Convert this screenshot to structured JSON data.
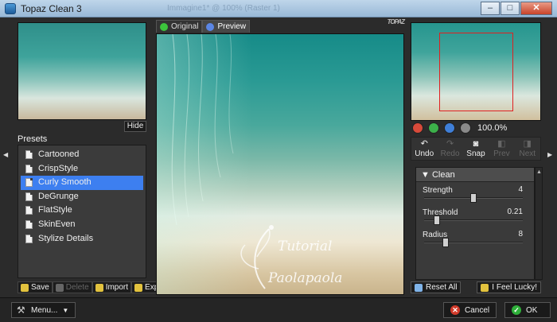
{
  "window": {
    "title": "Topaz Clean 3",
    "ghost_title": "Immagine1* @ 100% (Raster 1)",
    "controls": {
      "minimize": "–",
      "maximize": "□",
      "close": "✕"
    }
  },
  "presets": {
    "hide_label": "Hide",
    "label": "Presets",
    "items": [
      "Cartooned",
      "CrispStyle",
      "Curly Smooth",
      "DeGrunge",
      "FlatStyle",
      "SkinEven",
      "Stylize Details"
    ],
    "selected": "Curly Smooth",
    "buttons": {
      "save": "Save",
      "delete": "Delete",
      "import": "Import",
      "export": "Export"
    }
  },
  "preview": {
    "tabs": {
      "original": "Original",
      "preview": "Preview"
    },
    "logo_text": "TOPAZ",
    "watermark": {
      "line1": "Tutorial",
      "line2": "Paolapaola"
    }
  },
  "navigator": {
    "zoom_level": "100.0%"
  },
  "history": {
    "undo": "Undo",
    "redo": "Redo",
    "snap": "Snap",
    "prev": "Prev",
    "next": "Next"
  },
  "clean_panel": {
    "header": "Clean",
    "params": [
      {
        "label": "Strength",
        "value": "4",
        "fraction": 0.5
      },
      {
        "label": "Threshold",
        "value": "0.21",
        "fraction": 0.1
      },
      {
        "label": "Radius",
        "value": "8",
        "fraction": 0.2
      }
    ]
  },
  "right_buttons": {
    "reset_all": "Reset All",
    "feel_lucky": "I Feel Lucky!"
  },
  "bottom": {
    "menu": "Menu...",
    "cancel": "Cancel",
    "ok": "OK"
  },
  "colors": {
    "accent": "#3d7ff0",
    "cancel": "#d23a2a",
    "ok": "#2fb03a"
  }
}
